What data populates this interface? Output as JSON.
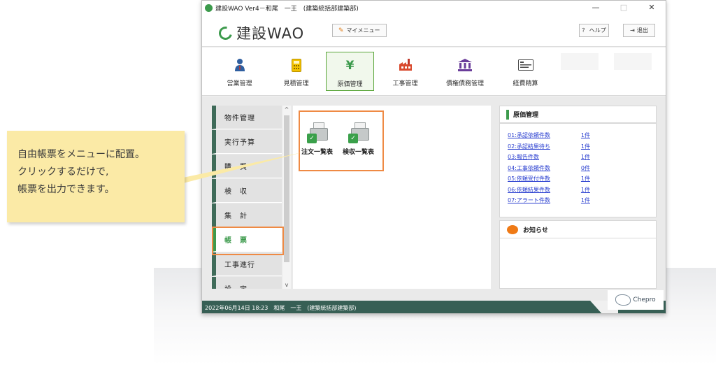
{
  "window": {
    "title": "建設WAO Ver4－和尾　一王　(建築統括部建築部)",
    "controls": [
      "—",
      "□",
      "✕"
    ]
  },
  "header": {
    "logo_text": "建設WAO",
    "mymenu_label": "マイメニュー",
    "help_label": "？ ヘルプ",
    "exit_label": "退出"
  },
  "menubar": {
    "items": [
      {
        "label": "営業管理",
        "icon": "person-icon"
      },
      {
        "label": "見積管理",
        "icon": "calculator-icon"
      },
      {
        "label": "原価管理",
        "icon": "yen-icon",
        "glyph": "¥",
        "active": true
      },
      {
        "label": "工事管理",
        "icon": "factory-icon"
      },
      {
        "label": "債権債務管理",
        "icon": "bank-icon"
      },
      {
        "label": "経費精算",
        "icon": "receipt-icon"
      }
    ]
  },
  "sidebar": {
    "items": [
      {
        "label": "物件管理"
      },
      {
        "label": "実行予算"
      },
      {
        "label": "購　買"
      },
      {
        "label": "検　収"
      },
      {
        "label": "集　計"
      },
      {
        "label": "帳　票",
        "active": true
      },
      {
        "label": "工事進行"
      },
      {
        "label": "設　定"
      }
    ],
    "scroll_up": "^",
    "scroll_down": "v"
  },
  "report_panel": {
    "items": [
      {
        "label": "注文一覧表"
      },
      {
        "label": "検収一覧表"
      }
    ]
  },
  "cost_box": {
    "title": "原価管理",
    "rows": [
      {
        "name": "01:承認依頼件数",
        "count": "1件"
      },
      {
        "name": "02:承認結果待ち",
        "count": "1件"
      },
      {
        "name": "03:報告件数",
        "count": "1件"
      },
      {
        "name": "04:工事依頼件数",
        "count": "0件"
      },
      {
        "name": "05:依頼受付件数",
        "count": "1件"
      },
      {
        "name": "06:依頼結果件数",
        "count": "1件"
      },
      {
        "name": "07:アラート件数",
        "count": "1件"
      }
    ]
  },
  "notice_box": {
    "title": "お知らせ"
  },
  "statusbar": {
    "text": "2022年06月14日 18:23　和尾　一王　(建築統括部建築部)"
  },
  "brand": {
    "text": "Chepro"
  },
  "callout": {
    "lines": [
      "自由帳票をメニューに配置。",
      "クリックするだけで,",
      "帳票を出力できます。"
    ]
  },
  "colors": {
    "accent_green": "#3c9a4c",
    "sidebar_dark": "#3f6b59",
    "highlight_orange": "#ef8a44",
    "callout_yellow": "#fbeaa6",
    "link_blue": "#2a3fd0"
  }
}
